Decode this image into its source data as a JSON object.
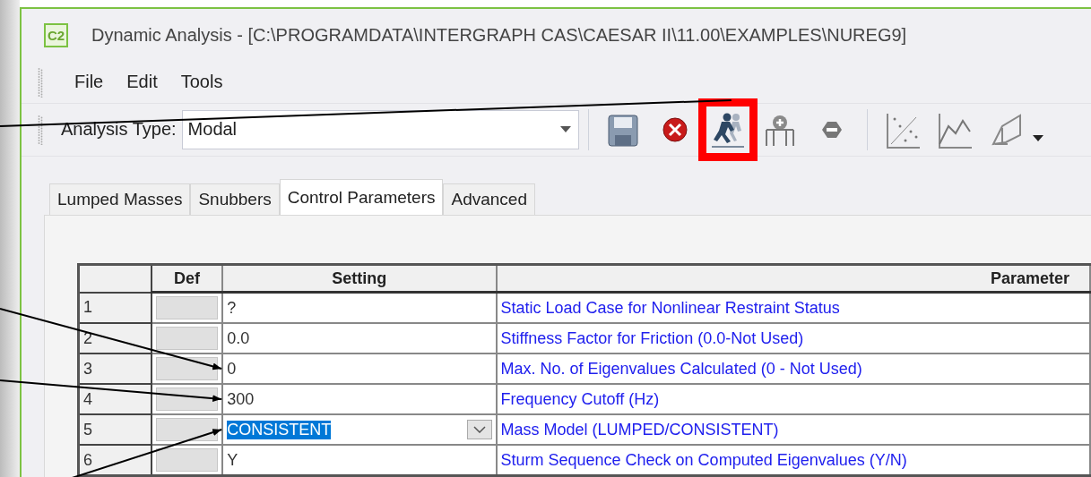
{
  "window": {
    "title": "Dynamic Analysis - [C:\\PROGRAMDATA\\INTERGRAPH CAS\\CAESAR II\\11.00\\EXAMPLES\\NUREG9]",
    "app_badge": "C2"
  },
  "menu": [
    "File",
    "Edit",
    "Tools"
  ],
  "toolbar": {
    "label": "Analysis Type:",
    "value": "Modal"
  },
  "tabs": [
    {
      "label": "Lumped Masses",
      "selected": false
    },
    {
      "label": "Snubbers",
      "selected": false
    },
    {
      "label": "Control Parameters",
      "selected": true
    },
    {
      "label": "Advanced",
      "selected": false
    }
  ],
  "table": {
    "columns": [
      "Def",
      "Setting",
      "Parameter"
    ],
    "rows": [
      {
        "number": "1",
        "setting": "?",
        "parameter": "Static Load Case for Nonlinear Restraint Status",
        "kind": "text",
        "text_selected": false,
        "pointed": false
      },
      {
        "number": "2",
        "setting": "0.0",
        "parameter": "Stiffness Factor for Friction (0.0-Not Used)",
        "kind": "text",
        "text_selected": false,
        "pointed": false
      },
      {
        "number": "3",
        "setting": "0",
        "parameter": "Max. No. of Eigenvalues Calculated (0 - Not Used)",
        "kind": "text",
        "text_selected": false,
        "pointed": true
      },
      {
        "number": "4",
        "setting": "300",
        "parameter": "Frequency Cutoff (Hz)",
        "kind": "text",
        "text_selected": false,
        "pointed": true
      },
      {
        "number": "5",
        "setting": "CONSISTENT",
        "parameter": "Mass Model (LUMPED/CONSISTENT)",
        "kind": "dropdown",
        "text_selected": true,
        "pointed": true
      },
      {
        "number": "6",
        "setting": "Y",
        "parameter": "Sturm Sequence Check on Computed Eigenvalues (Y/N)",
        "kind": "text",
        "text_selected": false,
        "pointed": false
      }
    ]
  }
}
